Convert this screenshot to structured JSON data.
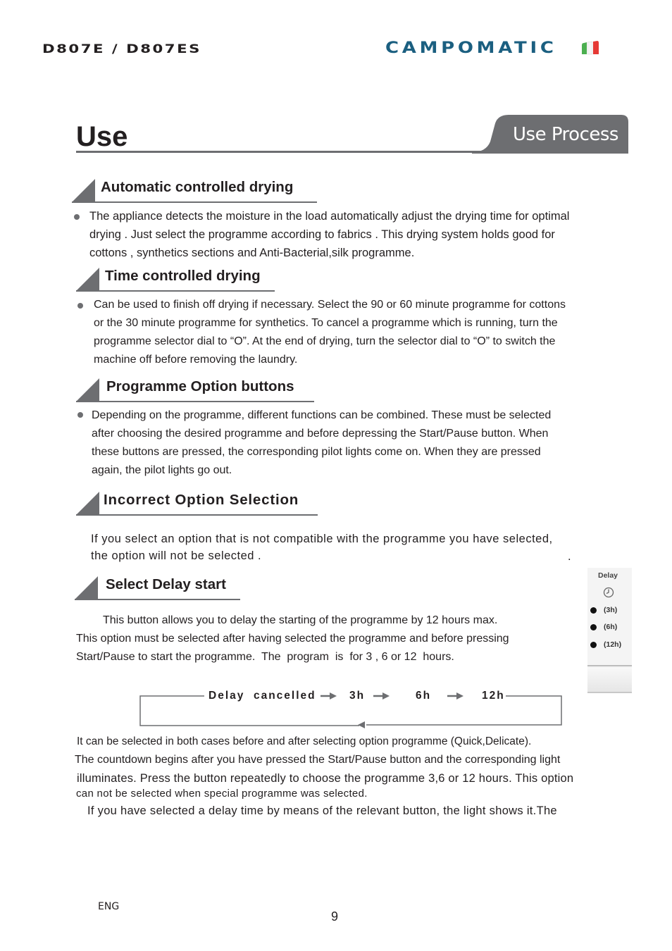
{
  "header": {
    "model": "D807E / D807ES",
    "brand": "CAMPOMATIC",
    "flag_colors": [
      "#4caf50",
      "#ffffff",
      "#e53935"
    ],
    "brand_color": "#1b5f80"
  },
  "title": {
    "text": "Use",
    "tab_label": "Use Process",
    "tab_color": "#6d6e71"
  },
  "sections": [
    {
      "heading": "Automatic controlled drying",
      "lines": [
        "The appliance detects the moisture in the load automatically adjust the drying time for optimal",
        "drying . Just select the programme according to fabrics . This drying system holds good for",
        "cottons , synthetics sections and Anti-Bacterial,silk programme."
      ]
    },
    {
      "heading": "Time controlled drying",
      "lines": [
        "Can be used to finish off drying if necessary. Select the 90 or 60 minute programme for cottons",
        "or the 30 minute programme for synthetics. To cancel a programme which is running, turn the",
        "programme selector dial to “O”. At the end of drying, turn the selector dial to “O” to switch the",
        "machine off before removing the laundry."
      ]
    },
    {
      "heading": "Programme Option buttons",
      "lines": [
        "Depending on the programme, different functions can be combined. These must be selected",
        "after choosing the desired programme and before depressing the Start/Pause button. When",
        "these buttons are pressed, the corresponding pilot lights come on. When they are pressed",
        "again, the pilot lights go out."
      ]
    },
    {
      "heading": "Incorrect Option Selection",
      "lines": [
        "If you select an option that is not compatible with the programme you have selected,",
        "the option will not be selected ."
      ],
      "stray_mark": "."
    },
    {
      "heading": "Select Delay start",
      "lines": [
        "This button allows you to delay the starting of the programme by 12 hours max.",
        "This option must be selected after having selected the programme and before pressing",
        "Start/Pause to start the programme.  The  program  is  for 3 , 6 or 12  hours."
      ]
    }
  ],
  "delay_panel": {
    "title": "Delay",
    "icon": "clock-icon",
    "options": [
      "(3h)",
      "(6h)",
      "(12h)"
    ]
  },
  "delay_flow": {
    "steps": [
      "Delay  cancelled",
      "3h",
      "6h",
      "12h"
    ]
  },
  "delay_notes": [
    "It can be selected in both cases before and after selecting option programme (Quick,Delicate).",
    "The countdown begins after you have pressed the Start/Pause button and the corresponding light",
    "illuminates. Press the button repeatedly to choose the programme 3,6 or 12 hours. This option",
    "can not be selected when special programme was selected.",
    "If you have selected a delay time by means of the relevant button, the light shows it.The"
  ],
  "footer": {
    "language": "ENG",
    "page_number": "9"
  }
}
